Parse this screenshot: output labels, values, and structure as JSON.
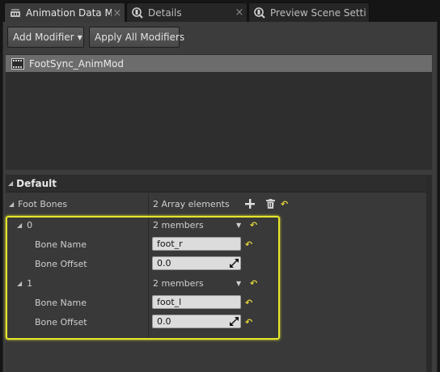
{
  "tabs": [
    {
      "label": "Animation Data Mc",
      "icon": "animation-data-icon",
      "active": true
    },
    {
      "label": "Details",
      "icon": "details-search-icon",
      "active": false
    },
    {
      "label": "Preview Scene Setti",
      "icon": "preview-scene-search-icon",
      "active": false
    }
  ],
  "toolbar": {
    "add_modifier_label": "Add Modifier",
    "apply_all_label": "Apply All Modifiers"
  },
  "modifier_list": {
    "items": [
      {
        "label": "FootSync_AnimMod",
        "icon": "anim-modifier-icon"
      }
    ]
  },
  "details": {
    "category": "Default",
    "foot_bones": {
      "label": "Foot Bones",
      "value": "2 Array elements"
    },
    "elements": [
      {
        "index_label": "0",
        "summary": "2 members",
        "bone_name_label": "Bone Name",
        "bone_name_value": "foot_r",
        "bone_offset_label": "Bone Offset",
        "bone_offset_value": "0.0"
      },
      {
        "index_label": "1",
        "summary": "2 members",
        "bone_name_label": "Bone Name",
        "bone_name_value": "foot_l",
        "bone_offset_label": "Bone Offset",
        "bone_offset_value": "0.0"
      }
    ]
  },
  "colors": {
    "highlight": "#e6e62c",
    "reset_arrow": "#e0d23a",
    "selected_item": "#6c6c6c"
  }
}
